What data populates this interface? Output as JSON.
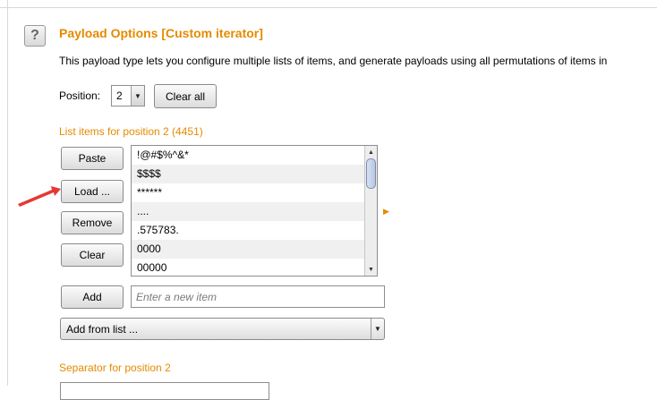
{
  "section": {
    "title": "Payload Options [Custom iterator]",
    "description": "This payload type lets you configure multiple lists of items, and generate payloads using all permutations of items in"
  },
  "position": {
    "label": "Position:",
    "selected": "2"
  },
  "buttons": {
    "clear_all": "Clear all",
    "paste": "Paste",
    "load": "Load ...",
    "remove": "Remove",
    "clear": "Clear",
    "add": "Add"
  },
  "list": {
    "header": "List items for position 2 (4451)",
    "items": [
      "!@#$%^&*",
      "$$$$",
      "******",
      "....",
      ".575783.",
      "0000",
      "00000"
    ]
  },
  "new_item": {
    "placeholder": "Enter a new item"
  },
  "add_from_list": {
    "selected": "Add from list ..."
  },
  "separator": {
    "label": "Separator for position 2"
  },
  "icons": {
    "help": "help-icon",
    "scroll_up": "arrow-up-icon",
    "scroll_down": "arrow-down-icon",
    "dropdown": "chevron-down-icon",
    "expand": "triangle-right-icon",
    "annotation": "red-arrow-icon"
  },
  "colors": {
    "accent_orange": "#e58a00",
    "annotation_red": "#e53935"
  }
}
